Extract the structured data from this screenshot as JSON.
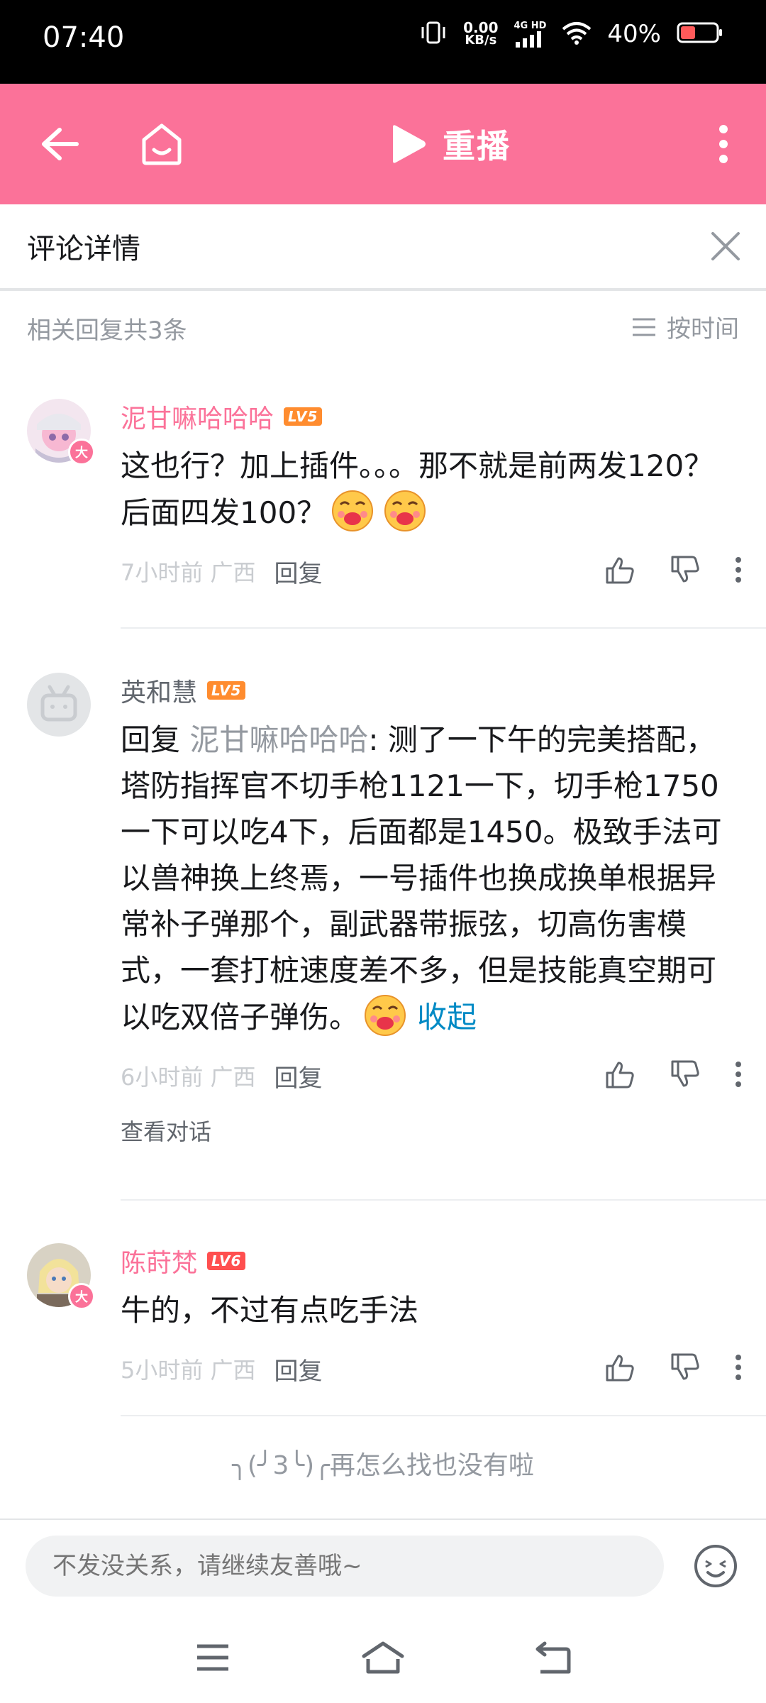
{
  "status_bar": {
    "time": "07:40",
    "net_speed_value": "0.00",
    "net_speed_unit": "KB/s",
    "signal_label": "4G HD",
    "battery": "40%"
  },
  "header": {
    "replay_label": "重播"
  },
  "detail": {
    "title": "评论详情",
    "reply_summary": "相关回复共3条",
    "sort_label": "按时间"
  },
  "comments": [
    {
      "username": "泥甘嘛哈哈哈",
      "level": "LV5",
      "text": "这也行？加上插件。。。那不就是前两发120？后面四发100？",
      "emotes": 2,
      "time_location": "7小时前  广西",
      "reply_label": "回复"
    },
    {
      "username": "英和慧",
      "level": "LV5",
      "reply_prefix": "回复 ",
      "reply_to": "泥甘嘛哈哈哈",
      "text": ": 测了一下午的完美搭配，塔防指挥官不切手枪1121一下，切手枪1750一下可以吃4下，后面都是1450。极致手法可以兽神换上终焉，一号插件也换成换单根据异常补子弹那个，副武器带振弦，切高伤害模式，一套打桩速度差不多，但是技能真空期可以吃双倍子弹伤。",
      "collapse_label": "收起",
      "time_location": "6小时前  广西",
      "reply_label": "回复",
      "view_conversation": "查看对话"
    },
    {
      "username": "陈莳梵",
      "level": "LV6",
      "text": "牛的，不过有点吃手法",
      "time_location": "5小时前  广西",
      "reply_label": "回复"
    }
  ],
  "end_note": "╮(╯3╰)╭再怎么找也没有啦",
  "input": {
    "placeholder": "不发没关系，请继续友善哦~"
  },
  "colors": {
    "brand_pink": "#fb7299",
    "link_blue": "#008ac5",
    "level_orange": "#ff8c2f"
  },
  "icons": [
    "back-arrow-icon",
    "home-icon",
    "play-icon",
    "more-vertical-icon",
    "close-icon",
    "sort-icon",
    "thumbs-up-icon",
    "thumbs-down-icon",
    "emoji-icon",
    "menu-icon",
    "nav-home-icon",
    "nav-back-icon"
  ]
}
